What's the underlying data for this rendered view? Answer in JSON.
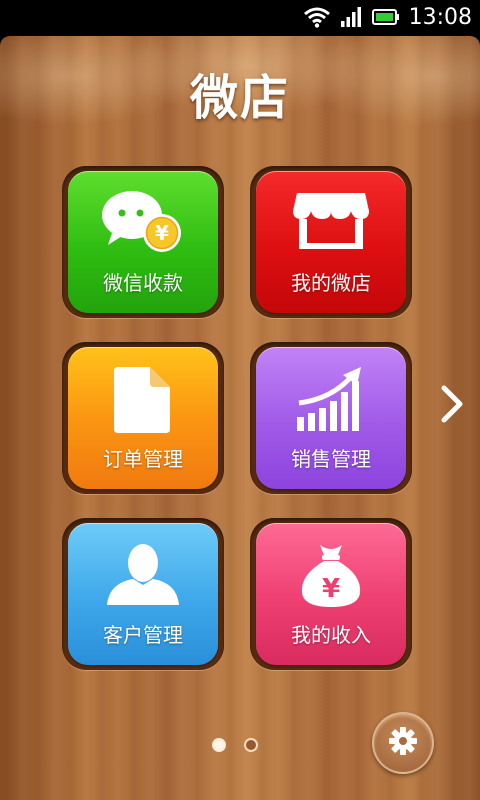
{
  "status_bar": {
    "time": "13:08",
    "icons": [
      "wifi-icon",
      "signal-icon",
      "battery-icon"
    ]
  },
  "app": {
    "title": "微店"
  },
  "tiles": [
    {
      "label": "微信收款",
      "icon": "wechat-payment-icon",
      "color": "#34c117"
    },
    {
      "label": "我的微店",
      "icon": "storefront-icon",
      "color": "#e01013"
    },
    {
      "label": "订单管理",
      "icon": "document-icon",
      "color": "#fa9a13"
    },
    {
      "label": "销售管理",
      "icon": "sales-growth-chart-icon",
      "color": "#a460ea"
    },
    {
      "label": "客户管理",
      "icon": "user-silhouette-icon",
      "color": "#43abeb"
    },
    {
      "label": "我的收入",
      "icon": "money-bag-icon",
      "color": "#ef4373"
    }
  ],
  "navigation": {
    "next_icon": "chevron-right-icon",
    "page_count": 2,
    "current_page": 1
  },
  "settings": {
    "icon": "gear-icon"
  }
}
